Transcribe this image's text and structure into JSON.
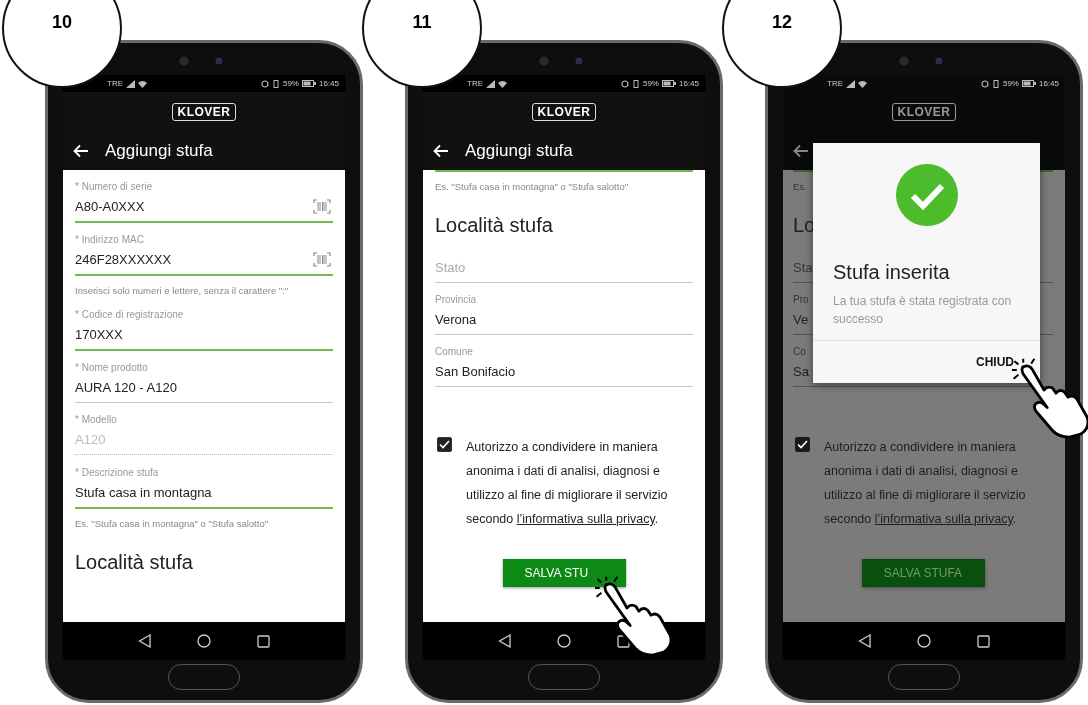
{
  "phones": [
    {
      "step": "10",
      "status": {
        "carrier": "TRE",
        "battery": "59%",
        "time": "16:45"
      },
      "logo": "KLOVER",
      "title": "Aggiungi stufa",
      "dimmed": false,
      "content": [
        {
          "kind": "field",
          "label": "* Numero di serie",
          "value": "A80-A0XXX",
          "highlighted": true,
          "disabled": false,
          "scanner": true
        },
        {
          "kind": "field",
          "label": "* Indirizzo MAC",
          "value": "246F28XXXXXX",
          "highlighted": true,
          "disabled": false,
          "scanner": true
        },
        {
          "kind": "hint",
          "text": "Inserisci solo numeri e lettere, senza il carattere \":\""
        },
        {
          "kind": "field",
          "label": "* Codice di registrazione",
          "value": "170XXX",
          "highlighted": true,
          "disabled": false,
          "scanner": false
        },
        {
          "kind": "field",
          "label": "* Nome prodotto",
          "value": "AURA 120 - A120",
          "highlighted": false,
          "disabled": false,
          "scanner": false
        },
        {
          "kind": "field",
          "label": "* Modello",
          "value": "A120",
          "highlighted": false,
          "disabled": true,
          "scanner": false
        },
        {
          "kind": "field",
          "label": "* Descrizione stufa",
          "value": "Stufa casa in montagna",
          "highlighted": true,
          "disabled": false,
          "scanner": false
        },
        {
          "kind": "hint",
          "text": "Es. \"Stufa casa in montagna\" o \"Stufa salotto\""
        },
        {
          "kind": "heading",
          "text": "Località stufa"
        }
      ]
    },
    {
      "step": "11",
      "status": {
        "carrier": "TRE",
        "battery": "59%",
        "time": "16:45"
      },
      "logo": "KLOVER",
      "title": "Aggiungi stufa",
      "dimmed": false,
      "content": [
        {
          "kind": "divider",
          "highlighted": true
        },
        {
          "kind": "hint",
          "text": "Es. \"Stufa casa in montagna\" o \"Stufa salotto\""
        },
        {
          "kind": "heading",
          "text": "Località stufa"
        },
        {
          "kind": "field",
          "placeholder": "Stato",
          "highlighted": false,
          "disabled": false,
          "scanner": false
        },
        {
          "kind": "field",
          "label": "Provincia",
          "value": "Verona",
          "highlighted": false,
          "disabled": false,
          "scanner": false
        },
        {
          "kind": "field",
          "label": "Comune",
          "value": "San Bonifacio",
          "highlighted": false,
          "disabled": false,
          "scanner": false
        },
        {
          "kind": "consent",
          "checked": true,
          "text": "Autorizzo a condividere in maniera anonima i dati di analisi, diagnosi e utilizzo al fine di migliorare il servizio secondo",
          "link": "l’informativa sulla privacy",
          "end": "."
        },
        {
          "kind": "button",
          "label": "SALVA STU"
        }
      ]
    },
    {
      "step": "12",
      "status": {
        "carrier": "TRE",
        "battery": "59%",
        "time": "16:45"
      },
      "logo": "KLOVER",
      "dimmed": true,
      "content": [
        {
          "kind": "divider",
          "highlighted": true
        },
        {
          "kind": "hint",
          "text": "Es."
        },
        {
          "kind": "heading",
          "text": "Lo"
        },
        {
          "kind": "field",
          "placeholder": "Sta",
          "highlighted": false,
          "disabled": false
        },
        {
          "kind": "field",
          "label": "Pro",
          "value": "Ve",
          "highlighted": false,
          "disabled": false
        },
        {
          "kind": "field",
          "label": "Co",
          "value": "Sa",
          "highlighted": false,
          "disabled": false
        },
        {
          "kind": "consent",
          "checked": true,
          "text": "Autorizzo a condividere in maniera anonima i dati di analisi, diagnosi e utilizzo al fine di migliorare il servizio secondo",
          "link": "l’informativa sulla privacy",
          "end": "."
        },
        {
          "kind": "button",
          "label": "SALVA STUFA"
        }
      ],
      "dialog": {
        "title": "Stufa inserita",
        "message": "La tua stufa è stata registrata con successo",
        "action": "CHIUD"
      }
    }
  ]
}
